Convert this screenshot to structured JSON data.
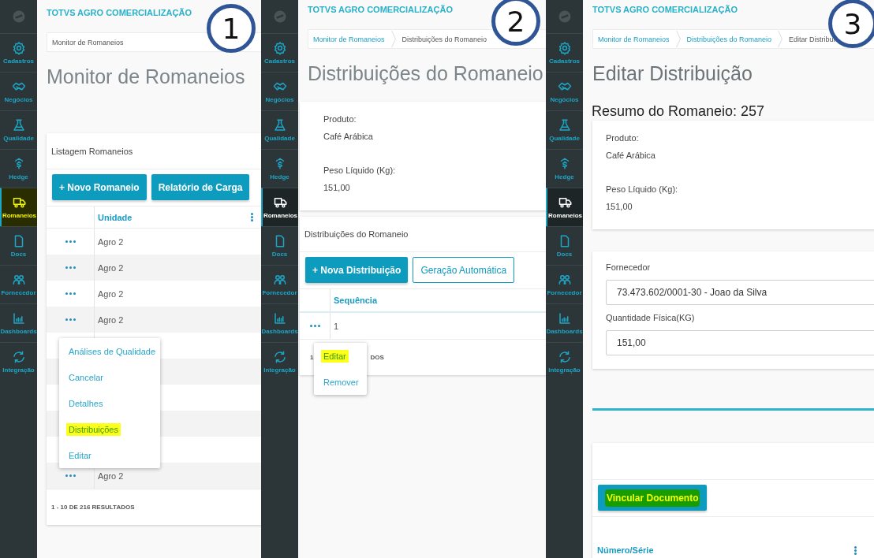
{
  "panels": [
    {
      "step": "1",
      "app_title": "TOTVS AGRO COMERCIALIZAÇÃO",
      "sidebar": {
        "items": [
          {
            "label": "Cadastros",
            "selected": false,
            "highlighted": false
          },
          {
            "label": "Negócios",
            "selected": false,
            "highlighted": false
          },
          {
            "label": "Qualidade",
            "selected": false,
            "highlighted": false
          },
          {
            "label": "Hedge",
            "selected": false,
            "highlighted": false
          },
          {
            "label": "Romaneios",
            "selected": true,
            "highlighted": true
          },
          {
            "label": "Docs",
            "selected": false,
            "highlighted": false
          },
          {
            "label": "Fornecedor",
            "selected": false,
            "highlighted": false
          },
          {
            "label": "Dashboards",
            "selected": false,
            "highlighted": false
          },
          {
            "label": "Integração",
            "selected": false,
            "highlighted": false
          }
        ]
      },
      "breadcrumb": [
        {
          "label": "Monitor de Romaneios",
          "current": true
        }
      ],
      "page_title": "Monitor de Romaneios",
      "sections": [
        {
          "kind": "list",
          "title": "Listagem Romaneios",
          "buttons": [
            {
              "label": "+ Novo Romaneio",
              "kind": "filled",
              "highlighted": false
            },
            {
              "label": "Relatório de Carga",
              "kind": "filled",
              "highlighted": false
            }
          ],
          "actions_column": true,
          "columns": [
            "Unidade"
          ],
          "column_menu": true,
          "rows": [
            {
              "cells": [
                "Agro 2"
              ]
            },
            {
              "cells": [
                "Agro 2"
              ]
            },
            {
              "cells": [
                "Agro 2"
              ]
            },
            {
              "cells": [
                "Agro 2"
              ],
              "menu": [
                {
                  "label": "Análises de Qualidade",
                  "highlighted": false
                },
                {
                  "label": "Cancelar",
                  "highlighted": false
                },
                {
                  "label": "Detalhes",
                  "highlighted": false
                },
                {
                  "label": "Distribuições",
                  "highlighted": true
                },
                {
                  "label": "Editar",
                  "highlighted": false
                }
              ]
            },
            {},
            {},
            {},
            {},
            {},
            {
              "cells": [
                "Agro 2"
              ]
            }
          ],
          "footer": [
            "1 - 10 DE 216 RESULTADOS"
          ]
        }
      ]
    },
    {
      "step": "2",
      "app_title": "TOTVS AGRO COMERCIALIZAÇÃO",
      "sidebar": {
        "items": [
          {
            "label": "Cadastros",
            "selected": false,
            "highlighted": false
          },
          {
            "label": "Negócios",
            "selected": false,
            "highlighted": false
          },
          {
            "label": "Qualidade",
            "selected": false,
            "highlighted": false
          },
          {
            "label": "Hedge",
            "selected": false,
            "highlighted": false
          },
          {
            "label": "Romaneios",
            "selected": true,
            "highlighted": false
          },
          {
            "label": "Docs",
            "selected": false,
            "highlighted": false
          },
          {
            "label": "Fornecedor",
            "selected": false,
            "highlighted": false
          },
          {
            "label": "Dashboards",
            "selected": false,
            "highlighted": false
          },
          {
            "label": "Integração",
            "selected": false,
            "highlighted": false
          }
        ]
      },
      "breadcrumb": [
        {
          "label": "Monitor de Romaneios",
          "current": false
        },
        {
          "label": "Distribuições do Romaneio",
          "current": true
        }
      ],
      "page_title": "Distribuições do Romaneio",
      "sections": [
        {
          "kind": "summary",
          "fields": [
            {
              "label": "Produto:",
              "value": "Café Arábica"
            },
            {
              "label": "Peso Líquido (Kg):",
              "value": "151,00"
            }
          ]
        },
        {
          "kind": "list",
          "title": "Distribuições do Romaneio",
          "buttons": [
            {
              "label": "+ Nova Distribuição",
              "kind": "filled",
              "highlighted": false
            },
            {
              "label": "Geração Automática",
              "kind": "outlined",
              "highlighted": false
            }
          ],
          "actions_column": true,
          "columns": [
            "Sequência"
          ],
          "column_menu": false,
          "rows": [
            {
              "cells": [
                "1"
              ],
              "menu": [
                {
                  "label": "Editar",
                  "highlighted": true
                },
                {
                  "label": "Remover",
                  "highlighted": false
                }
              ]
            }
          ],
          "footer": [
            "1",
            "DOS"
          ]
        }
      ]
    },
    {
      "step": "3",
      "app_title": "TOTVS AGRO COMERCIALIZAÇÃO",
      "sidebar": {
        "items": [
          {
            "label": "Cadastros",
            "selected": false,
            "highlighted": false
          },
          {
            "label": "Negócios",
            "selected": false,
            "highlighted": false
          },
          {
            "label": "Qualidade",
            "selected": false,
            "highlighted": false
          },
          {
            "label": "Hedge",
            "selected": false,
            "highlighted": false
          },
          {
            "label": "Romaneios",
            "selected": true,
            "highlighted": false
          },
          {
            "label": "Docs",
            "selected": false,
            "highlighted": false
          },
          {
            "label": "Fornecedor",
            "selected": false,
            "highlighted": false
          },
          {
            "label": "Dashboards",
            "selected": false,
            "highlighted": false
          },
          {
            "label": "Integração",
            "selected": false,
            "highlighted": false
          }
        ]
      },
      "breadcrumb": [
        {
          "label": "Monitor de Romaneios",
          "current": false
        },
        {
          "label": "Distribuições do Romaneio",
          "current": false
        },
        {
          "label": "Editar Distribui",
          "current": true
        }
      ],
      "page_title": "Editar Distribuição",
      "sections": [
        {
          "kind": "heading",
          "text": "Resumo do Romaneio: 257"
        },
        {
          "kind": "summary",
          "fields": [
            {
              "label": "Produto:",
              "value": "Café Arábica"
            },
            {
              "label": "Peso Líquido (Kg):",
              "value": "151,00"
            }
          ]
        },
        {
          "kind": "form",
          "fields": [
            {
              "label": "Fornecedor",
              "value": "73.473.602/0001-30 - Joao da Silva"
            },
            {
              "label": "Quantidade Física(KG)",
              "value": "151,00"
            }
          ]
        },
        {
          "kind": "divider"
        },
        {
          "kind": "list",
          "buttons": [
            {
              "label": "Vincular Documento",
              "kind": "filled",
              "highlighted": true
            }
          ],
          "actions_column": false,
          "columns": [
            "Número/Série"
          ],
          "column_menu": true
        }
      ]
    }
  ]
}
